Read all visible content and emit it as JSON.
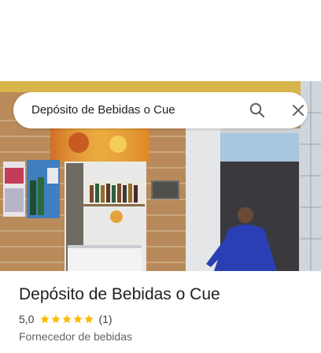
{
  "search": {
    "query": "Depósito de Bebidas o Cue"
  },
  "place": {
    "name": "Depósito de Bebidas o Cue",
    "rating_value": "5,0",
    "rating_stars": 5,
    "review_count": "(1)",
    "category": "Fornecedor de bebidas",
    "star_color": "#fbbc04"
  },
  "photo": {
    "sign_text": "SKOL",
    "poster_text": "VIVA"
  },
  "icons": {
    "search": "search-icon",
    "close": "close-icon",
    "star": "star-icon"
  }
}
